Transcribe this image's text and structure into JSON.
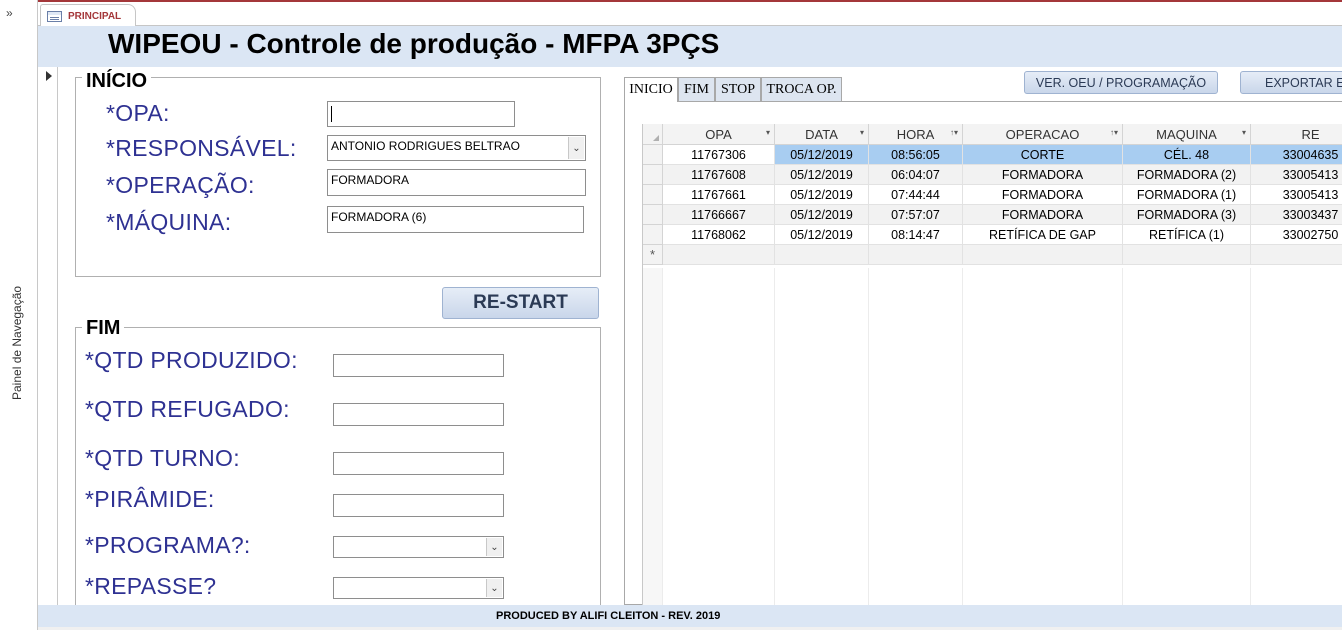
{
  "nav_pane": {
    "expand_glyph": "»",
    "label": "Painel de Navegação"
  },
  "document_tab": {
    "label": "PRINCIPAL",
    "icon": "form-icon"
  },
  "header": {
    "title": "WIPEOU - Controle de produção - MFPA 3PÇS"
  },
  "inicio": {
    "legend": "INÍCIO",
    "opa_label": "*OPA:",
    "opa_value": "",
    "responsavel_label": "*RESPONSÁVEL:",
    "responsavel_value": "ANTONIO RODRIGUES BELTRAO",
    "operacao_label": "*OPERAÇÃO:",
    "operacao_value": "FORMADORA",
    "maquina_label": "*MÁQUINA:",
    "maquina_value": "FORMADORA (6)"
  },
  "restart_button": "RE-START",
  "fim": {
    "legend": "FIM",
    "qtd_produzido_label": "*QTD PRODUZIDO:",
    "qtd_produzido_value": "",
    "qtd_refugado_label": "*QTD REFUGADO:",
    "qtd_refugado_value": "",
    "qtd_turno_label": "*QTD TURNO:",
    "qtd_turno_value": "",
    "piramide_label": "*PIRÂMIDE:",
    "piramide_value": "",
    "programa_label": "*PROGRAMA?:",
    "programa_value": "",
    "repasse_label": "*REPASSE?",
    "repasse_value": ""
  },
  "tabs": [
    "INICIO",
    "FIM",
    "STOP",
    "TROCA OP."
  ],
  "actions": {
    "ver_oeu": "VER. OEU / PROGRAMAÇÃO",
    "exportar": "EXPORTAR EX"
  },
  "grid": {
    "columns": [
      "OPA",
      "DATA",
      "HORA",
      "OPERACAO",
      "MAQUINA",
      "RE"
    ],
    "rows": [
      [
        "11767306",
        "05/12/2019",
        "08:56:05",
        "CORTE",
        "CÉL. 48",
        "33004635"
      ],
      [
        "11767608",
        "05/12/2019",
        "06:04:07",
        "FORMADORA",
        "FORMADORA (2)",
        "33005413"
      ],
      [
        "11767661",
        "05/12/2019",
        "07:44:44",
        "FORMADORA",
        "FORMADORA (1)",
        "33005413"
      ],
      [
        "11766667",
        "05/12/2019",
        "07:57:07",
        "FORMADORA",
        "FORMADORA (3)",
        "33003437"
      ],
      [
        "11768062",
        "05/12/2019",
        "08:14:47",
        "RETÍFICA DE GAP",
        "RETÍFICA (1)",
        "33002750"
      ]
    ],
    "new_row_marker": "*"
  },
  "footer": {
    "text": "PRODUCED BY ALIFI CLEITON - REV. 2019"
  },
  "colors": {
    "accent": "#a4373a",
    "header_band": "#dbe6f4",
    "label_blue": "#2e3192",
    "selection": "#a8cdf1"
  }
}
